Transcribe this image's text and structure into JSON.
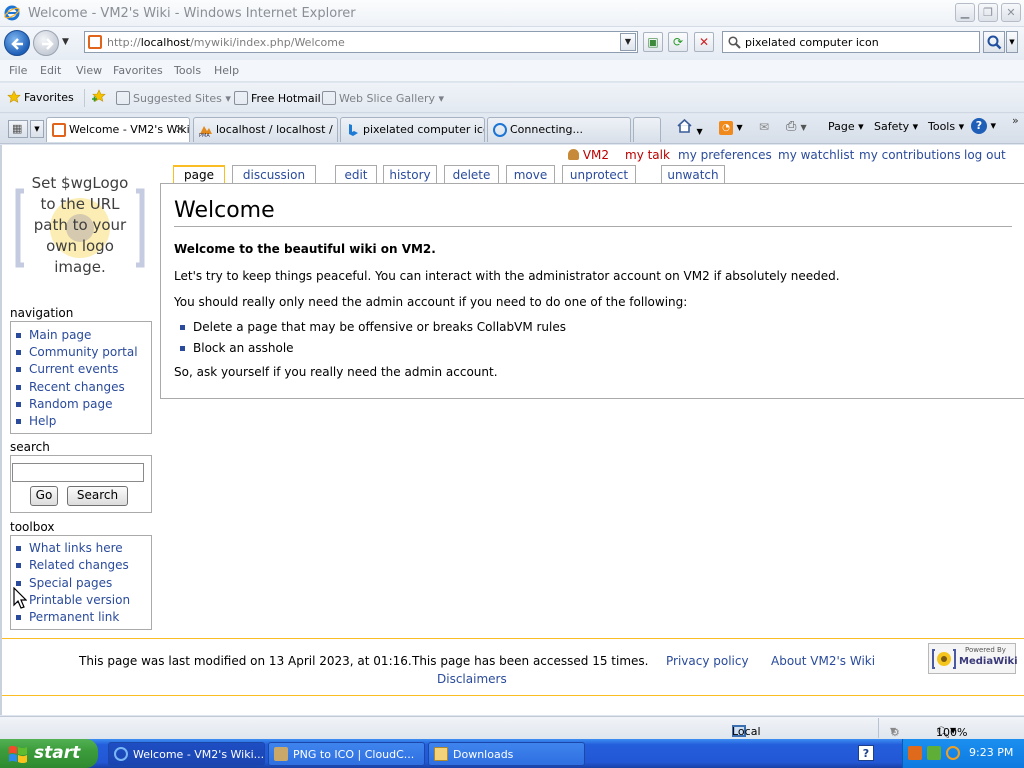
{
  "window": {
    "title": "Welcome - VM2's Wiki - Windows Internet Explorer"
  },
  "address": {
    "url_prefix": "http://",
    "url_host": "localhost",
    "url_path": "/mywiki/index.php/Welcome"
  },
  "search": {
    "value": "pixelated computer icon"
  },
  "menu": [
    "File",
    "Edit",
    "View",
    "Favorites",
    "Tools",
    "Help"
  ],
  "favorites_bar": {
    "favorites_label": "Favorites",
    "suggested": "Suggested Sites",
    "hotmail": "Free Hotmail",
    "webslice": "Web Slice Gallery"
  },
  "tabs": [
    {
      "label": "Welcome - VM2's Wiki"
    },
    {
      "label": "localhost / localhost / ..."
    },
    {
      "label": "pixelated computer ico..."
    },
    {
      "label": "Connecting..."
    }
  ],
  "commandbar": {
    "page": "Page",
    "safety": "Safety",
    "tools": "Tools"
  },
  "wiki": {
    "user_links": [
      "VM2",
      "my talk",
      "my preferences",
      "my watchlist",
      "my contributions",
      "log out"
    ],
    "logo_text": [
      "Set $wgLogo",
      "to the URL",
      "path to your",
      "own logo",
      "image."
    ],
    "page_tabs": [
      "page",
      "discussion",
      "edit",
      "history",
      "delete",
      "move",
      "unprotect",
      "unwatch"
    ],
    "heading": "Welcome",
    "intro_bold": "Welcome to the beautiful wiki on VM2.",
    "para1": "Let's try to keep things peaceful. You can interact with the administrator account on VM2 if absolutely needed.",
    "para2": "You should really only need the admin account if you need to do one of the following:",
    "bullets": [
      "Delete a page that may be offensive or breaks CollabVM rules",
      "Block an asshole"
    ],
    "para3": "So, ask yourself if you really need the admin account.",
    "navigation_label": "navigation",
    "navigation": [
      "Main page",
      "Community portal",
      "Current events",
      "Recent changes",
      "Random page",
      "Help"
    ],
    "search_label": "search",
    "go_button": "Go",
    "search_button": "Search",
    "toolbox_label": "toolbox",
    "toolbox": [
      "What links here",
      "Related changes",
      "Special pages",
      "Printable version",
      "Permanent link"
    ],
    "footer": {
      "modified": "This page was last modified on 13 April 2023, at 01:16.",
      "accessed": "This page has been accessed 15 times.",
      "privacy": "Privacy policy",
      "about": "About VM2's Wiki",
      "disclaimers": "Disclaimers",
      "badge_top": "Powered By",
      "badge_main": "MediaWiki"
    }
  },
  "status": {
    "zone": "Local intranet",
    "zoom": "100%"
  },
  "taskbar": {
    "start": "start",
    "items": [
      "Welcome - VM2's Wiki...",
      "PNG to ICO | CloudC...",
      "Downloads"
    ],
    "clock": "9:23 PM"
  }
}
